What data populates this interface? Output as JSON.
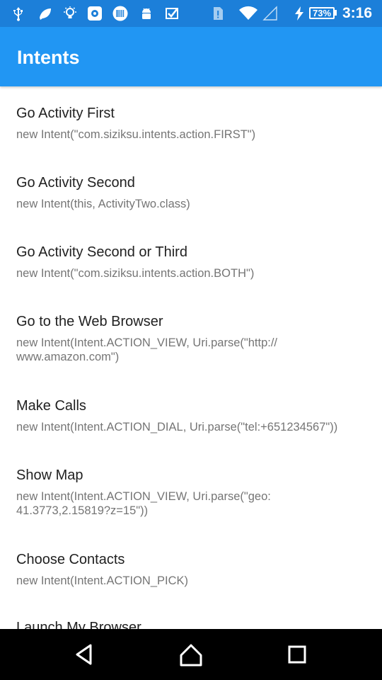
{
  "status_bar": {
    "icons": [
      "usb-icon",
      "leaf-icon",
      "bulb-icon",
      "photo-app-icon",
      "barcode-icon",
      "android-icon",
      "check-badge-icon",
      "sim-alert-icon",
      "wifi-icon",
      "cell-signal-icon",
      "charging-icon"
    ],
    "battery": "73%",
    "time": "3:16"
  },
  "app_bar": {
    "title": "Intents"
  },
  "list": {
    "items": [
      {
        "title": "Go Activity First",
        "subtitle": "new Intent(\"com.siziksu.intents.action.FIRST\")"
      },
      {
        "title": "Go Activity Second",
        "subtitle": "new Intent(this, ActivityTwo.class)"
      },
      {
        "title": "Go Activity Second or Third",
        "subtitle": "new Intent(\"com.siziksu.intents.action.BOTH\")"
      },
      {
        "title": "Go to the Web Browser",
        "subtitle": "new Intent(Intent.ACTION_VIEW, Uri.parse(\"http:// www.amazon.com\")"
      },
      {
        "title": "Make Calls",
        "subtitle": "new Intent(Intent.ACTION_DIAL, Uri.parse(\"tel:+651234567\"))"
      },
      {
        "title": "Show Map",
        "subtitle": "new Intent(Intent.ACTION_VIEW, Uri.parse(\"geo: 41.3773,2.15819?z=15\"))"
      },
      {
        "title": "Choose Contacts",
        "subtitle": "new Intent(Intent.ACTION_PICK)"
      },
      {
        "title": "Launch My Browser",
        "subtitle": ""
      }
    ]
  },
  "nav_bar": {
    "buttons": [
      "back-icon",
      "home-icon",
      "recents-icon"
    ]
  },
  "colors": {
    "status_bar": "#1c7fd9",
    "app_bar": "#2196f3",
    "title_text": "#212121",
    "subtitle_text": "#757575",
    "nav_bar": "#000000"
  }
}
